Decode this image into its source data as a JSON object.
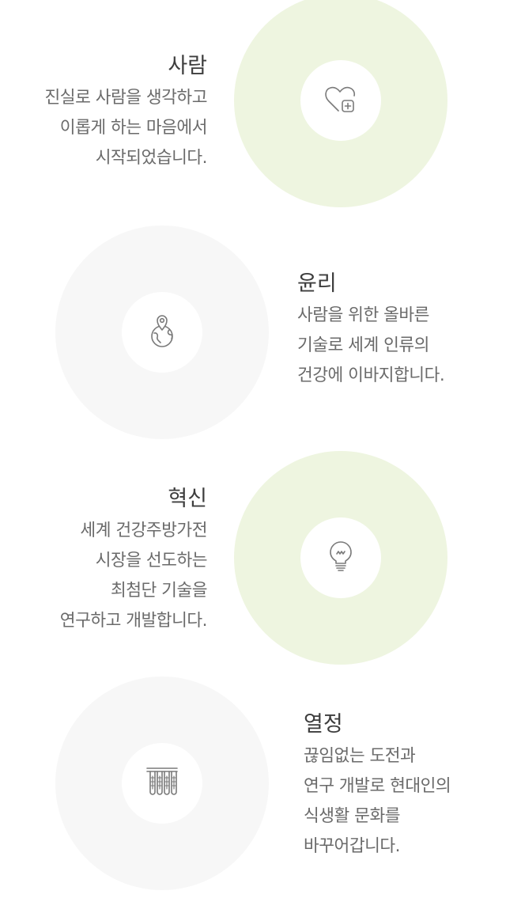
{
  "sections": [
    {
      "title": "사람",
      "lines": [
        "진실로 사람을 생각하고",
        "이롭게 하는 마음에서",
        "시작되었습니다."
      ],
      "icon": "heart-plus-icon",
      "circle_color": "#eef5e0"
    },
    {
      "title": "윤리",
      "lines": [
        "사람을 위한 올바른",
        "기술로 세계 인류의",
        "건강에 이바지합니다."
      ],
      "icon": "globe-pin-icon",
      "circle_color": "#f7f7f7"
    },
    {
      "title": "혁신",
      "lines": [
        "세계 건강주방가전",
        "시장을 선도하는",
        "최첨단 기술을",
        "연구하고 개발합니다."
      ],
      "icon": "lightbulb-icon",
      "circle_color": "#eef5e0"
    },
    {
      "title": "열정",
      "lines": [
        "끊임없는 도전과",
        "연구 개발로 현대인의",
        "식생활 문화를",
        "바꾸어갑니다."
      ],
      "icon": "test-tubes-icon",
      "circle_color": "#f7f7f7"
    }
  ],
  "colors": {
    "icon_stroke": "#7a7a7a",
    "text": "#6a6a6a",
    "title": "#3d3d3d"
  }
}
